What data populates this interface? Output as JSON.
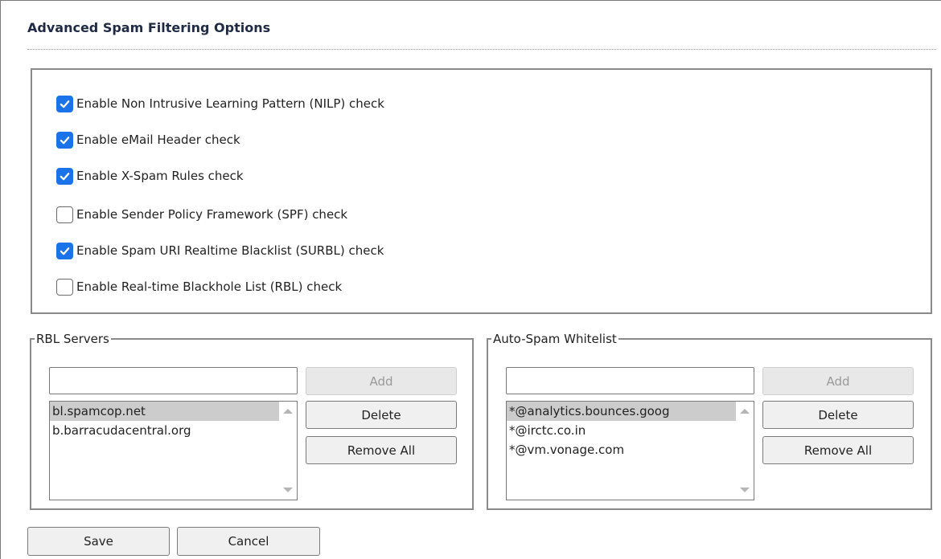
{
  "title": "Advanced Spam Filtering Options",
  "options": [
    {
      "label": "Enable Non Intrusive Learning Pattern (NILP) check",
      "checked": true
    },
    {
      "label": "Enable eMail Header check",
      "checked": true
    },
    {
      "label": "Enable X-Spam Rules check",
      "checked": true
    },
    {
      "label": "Enable Sender Policy Framework (SPF) check",
      "checked": false
    },
    {
      "label": "Enable Spam URI Realtime Blacklist (SURBL) check",
      "checked": true
    },
    {
      "label": "Enable Real-time Blackhole List (RBL) check",
      "checked": false
    }
  ],
  "rbl": {
    "legend": "RBL Servers",
    "input_value": "",
    "add_label": "Add",
    "delete_label": "Delete",
    "remove_all_label": "Remove All",
    "items": [
      "bl.spamcop.net",
      "b.barracudacentral.org"
    ],
    "selected_index": 0
  },
  "whitelist": {
    "legend": "Auto-Spam Whitelist",
    "input_value": "",
    "add_label": "Add",
    "delete_label": "Delete",
    "remove_all_label": "Remove All",
    "items": [
      "*@analytics.bounces.goog",
      "*@irctc.co.in",
      "*@vm.vonage.com"
    ],
    "selected_index": 0
  },
  "footer": {
    "save_label": "Save",
    "cancel_label": "Cancel"
  },
  "colors": {
    "checkbox_checked": "#1a73e8",
    "selection_bg": "#cccccc"
  }
}
